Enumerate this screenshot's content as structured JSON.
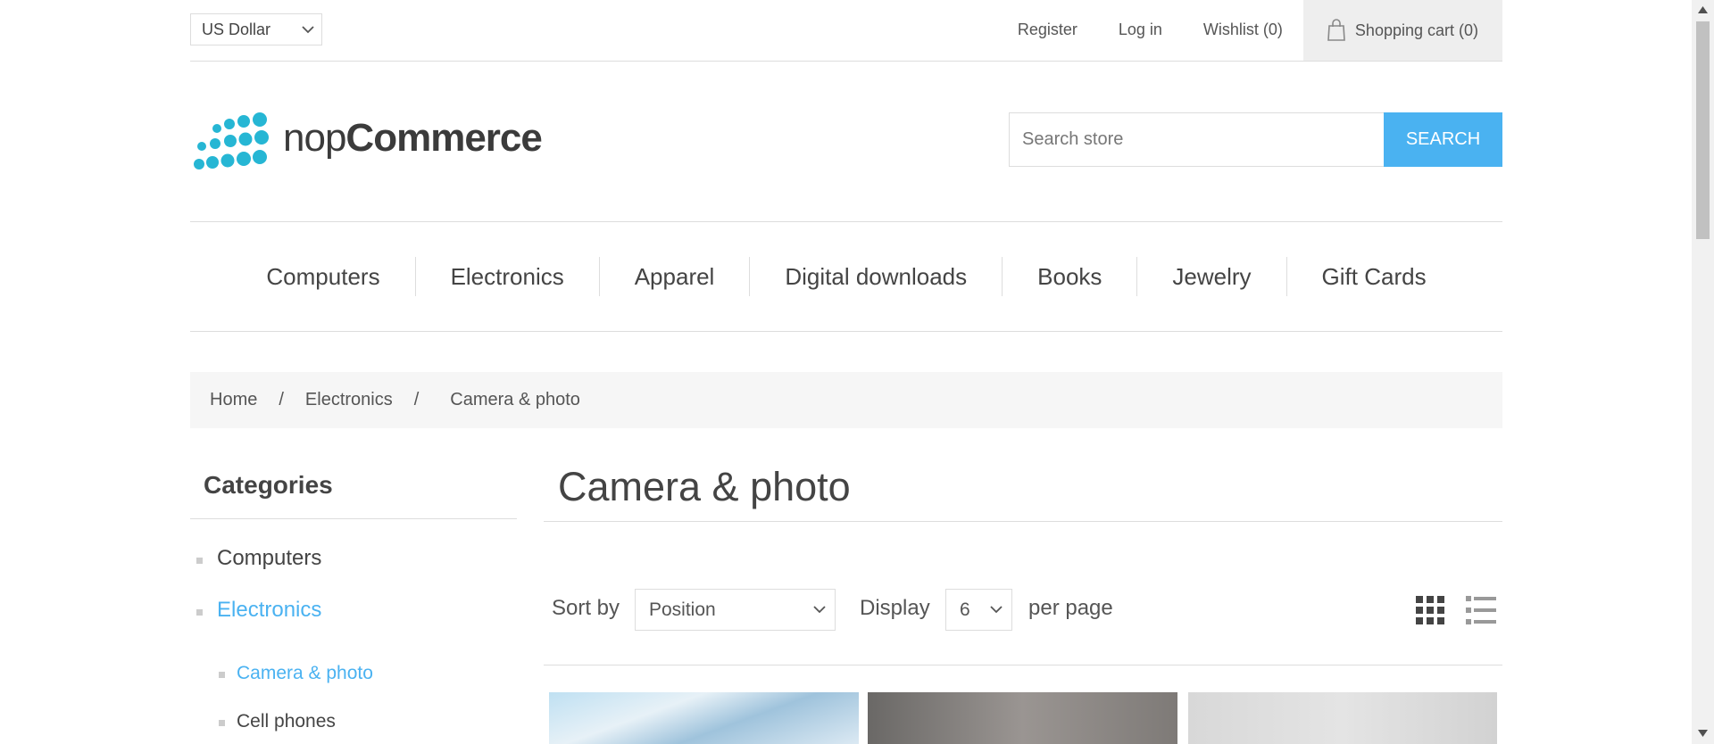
{
  "header": {
    "currency": {
      "selected": "US Dollar"
    },
    "links": {
      "register": "Register",
      "login": "Log in",
      "wishlist": "Wishlist (0)",
      "cart": "Shopping cart (0)"
    }
  },
  "logo": {
    "text_light": "nop",
    "text_bold": "Commerce",
    "accent_color": "#26b6d4"
  },
  "search": {
    "placeholder": "Search store",
    "button_label": "SEARCH",
    "button_color": "#4ab2f1"
  },
  "top_menu": [
    "Computers",
    "Electronics",
    "Apparel",
    "Digital downloads",
    "Books",
    "Jewelry",
    "Gift Cards"
  ],
  "breadcrumb": {
    "home": "Home",
    "separator": "/",
    "parent": "Electronics",
    "current": "Camera & photo"
  },
  "sidebar": {
    "title": "Categories",
    "items": [
      {
        "label": "Computers"
      },
      {
        "label": "Electronics"
      }
    ],
    "subitems": [
      {
        "label": "Camera & photo"
      },
      {
        "label": "Cell phones"
      }
    ],
    "active_color": "#4ab2f1"
  },
  "main": {
    "title": "Camera & photo",
    "sort_label": "Sort by",
    "sort_value": "Position",
    "display_label": "Display",
    "display_value": "6",
    "per_page_label": "per page",
    "view_modes": [
      "grid-icon",
      "list-icon"
    ]
  }
}
